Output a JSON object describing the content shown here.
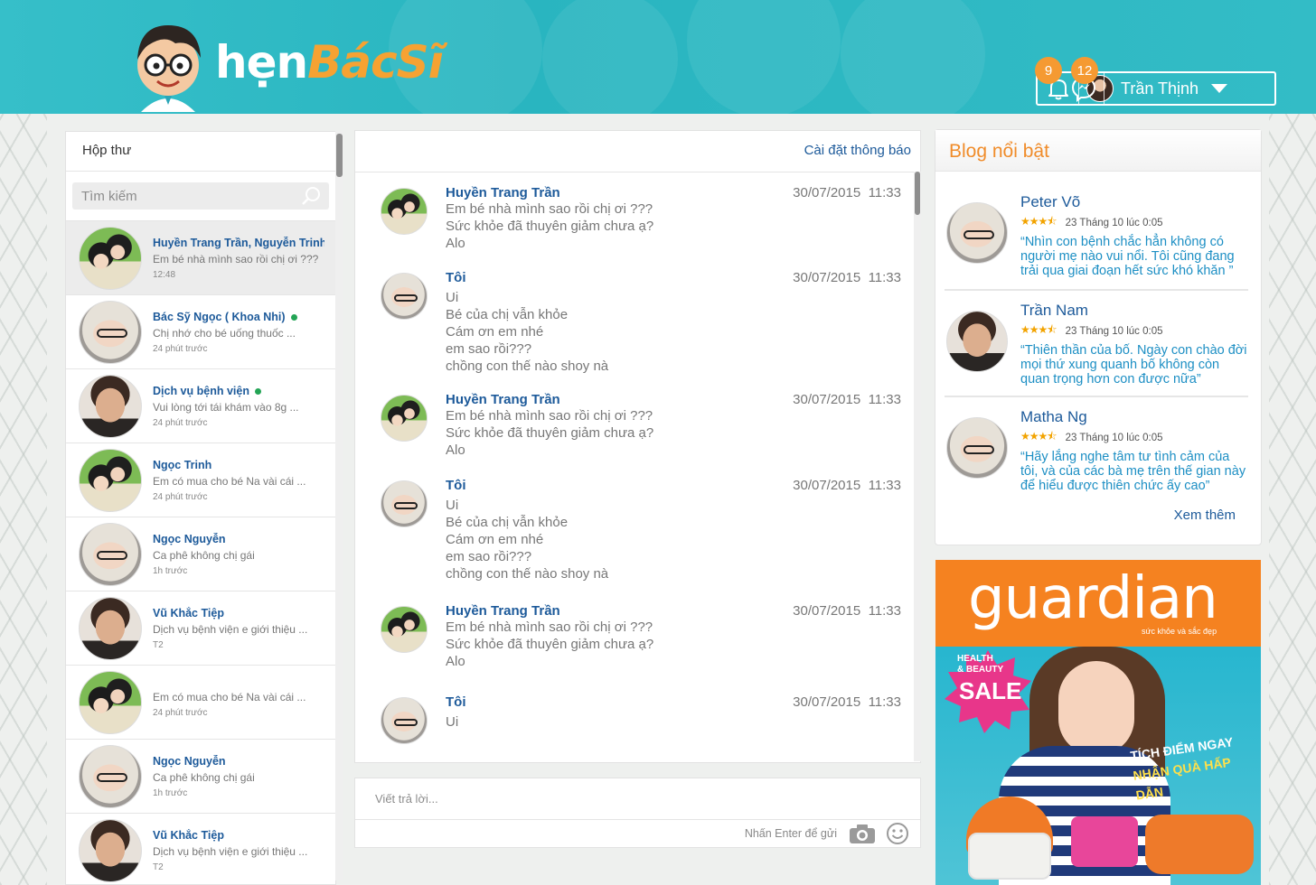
{
  "brand": {
    "logo_left": "hẹn",
    "logo_right": "BácSĩ"
  },
  "header": {
    "messages_badge": "9",
    "notifications_badge": "12",
    "user_name": "Trần Thịnh"
  },
  "inbox": {
    "title": "Hộp thư",
    "search_placeholder": "Tìm kiếm",
    "conversations": [
      {
        "name": "Huyền Trang Trần, Nguyễn Trinh",
        "preview": "Em bé nhà mình sao rồi chị ơi ???",
        "time": "12:48",
        "avatar": "mother",
        "online": false,
        "active": true
      },
      {
        "name": "Bác Sỹ Ngọc ( Khoa Nhi)",
        "preview": "Chị nhớ cho bé uống thuốc ...",
        "time": "24 phút trước",
        "avatar": "woman",
        "online": true,
        "active": false
      },
      {
        "name": "Dịch vụ bệnh viện",
        "preview": "Vui lòng tới tái khám vào 8g ...",
        "time": "24 phút trước",
        "avatar": "man",
        "online": true,
        "active": false
      },
      {
        "name": "Ngọc Trinh",
        "preview": "Em có mua cho bé Na vài cái ...",
        "time": "24 phút trước",
        "avatar": "mother",
        "online": false,
        "active": false
      },
      {
        "name": "Ngọc Nguyễn",
        "preview": "Ca phê không chị gái",
        "time": "1h trước",
        "avatar": "woman",
        "online": false,
        "active": false
      },
      {
        "name": "Vũ Khắc Tiệp",
        "preview": "Dịch vụ bệnh viện e giới thiệu ...",
        "time": "T2",
        "avatar": "man",
        "online": false,
        "active": false
      },
      {
        "name": "",
        "preview": "Em có mua cho bé Na vài cái ...",
        "time": "24 phút trước",
        "avatar": "mother",
        "online": false,
        "active": false
      },
      {
        "name": "Ngọc Nguyễn",
        "preview": "Ca phê không chị gái",
        "time": "1h trước",
        "avatar": "woman",
        "online": false,
        "active": false
      },
      {
        "name": "Vũ Khắc Tiệp",
        "preview": "Dịch vụ bệnh viện e giới thiệu ...",
        "time": "T2",
        "avatar": "man",
        "online": false,
        "active": false
      }
    ]
  },
  "chat": {
    "settings_link": "Cài đặt thông báo",
    "messages": [
      {
        "sender": "Huyền Trang Trần",
        "avatar": "mother",
        "date": "30/07/2015",
        "time": "11:33",
        "lines": [
          "Em bé nhà mình sao rồi chị ơi ???",
          "Sức khỏe đã thuyên giảm chưa ạ?",
          "Alo"
        ]
      },
      {
        "sender": "Tôi",
        "avatar": "woman",
        "date": "30/07/2015",
        "time": "11:33",
        "lines": [
          "Ui",
          "Bé của chị vẫn khỏe",
          "Cám ơn em nhé",
          "em sao rồi???",
          "chồng con thế nào shoy nà"
        ]
      },
      {
        "sender": "Huyền Trang Trần",
        "avatar": "mother",
        "date": "30/07/2015",
        "time": "11:33",
        "lines": [
          "Em bé nhà mình sao rồi chị ơi ???",
          "Sức khỏe đã thuyên giảm chưa ạ?",
          "Alo"
        ]
      },
      {
        "sender": "Tôi",
        "avatar": "woman",
        "date": "30/07/2015",
        "time": "11:33",
        "lines": [
          "Ui",
          "Bé của chị vẫn khỏe",
          "Cám ơn em nhé",
          "em sao rồi???",
          "chồng con thế nào shoy nà"
        ]
      },
      {
        "sender": "Huyền Trang Trần",
        "avatar": "mother",
        "date": "30/07/2015",
        "time": "11:33",
        "lines": [
          "Em bé nhà mình sao rồi chị ơi ???",
          "Sức khỏe đã thuyên giảm chưa ạ?",
          "Alo"
        ]
      },
      {
        "sender": "Tôi",
        "avatar": "woman",
        "date": "30/07/2015",
        "time": "11:33",
        "lines": [
          "Ui"
        ]
      }
    ],
    "reply_placeholder": "Viết trả lời...",
    "reply_hint": "Nhấn Enter để gửi"
  },
  "blog": {
    "title": "Blog nổi bật",
    "more_link": "Xem thêm",
    "posts": [
      {
        "author": "Peter Võ",
        "rating": 3.5,
        "date": "23 Tháng 10 lúc 0:05",
        "quote": "“Nhìn con bệnh chắc hẳn không có người mẹ nào vui nổi. Tôi cũng đang trải qua giai đoạn hết sức khó khăn ”",
        "avatar": "woman"
      },
      {
        "author": "Trần Nam",
        "rating": 3.5,
        "date": "23 Tháng 10 lúc 0:05",
        "quote": "“Thiên thần của bố. Ngày con chào đời mọi thứ xung quanh bố không còn quan trọng hơn con được nữa”",
        "avatar": "man"
      },
      {
        "author": "Matha Ng",
        "rating": 3.5,
        "date": "23 Tháng 10 lúc 0:05",
        "quote": "“Hãy lắng nghe tâm tư tình cảm của tôi, và của các bà mẹ trên thế gian này để hiểu được thiên chức ấy cao”",
        "avatar": "woman"
      }
    ]
  },
  "ad": {
    "brand": "guardian",
    "tagline": "sức khỏe và sắc đẹp",
    "badge_line1": "HEALTH",
    "badge_line2": "& BEAUTY",
    "badge_big": "SALE",
    "promo_line1": "TÍCH ĐIỂM NGAY",
    "promo_line2": "NHẬN QUÀ HẤP DẪN"
  },
  "colors": {
    "header_teal": "#29b5c0",
    "accent_orange": "#f59a32",
    "link_blue": "#1d5a9a",
    "quote_blue": "#1d8fc4",
    "online_green": "#23a455"
  }
}
